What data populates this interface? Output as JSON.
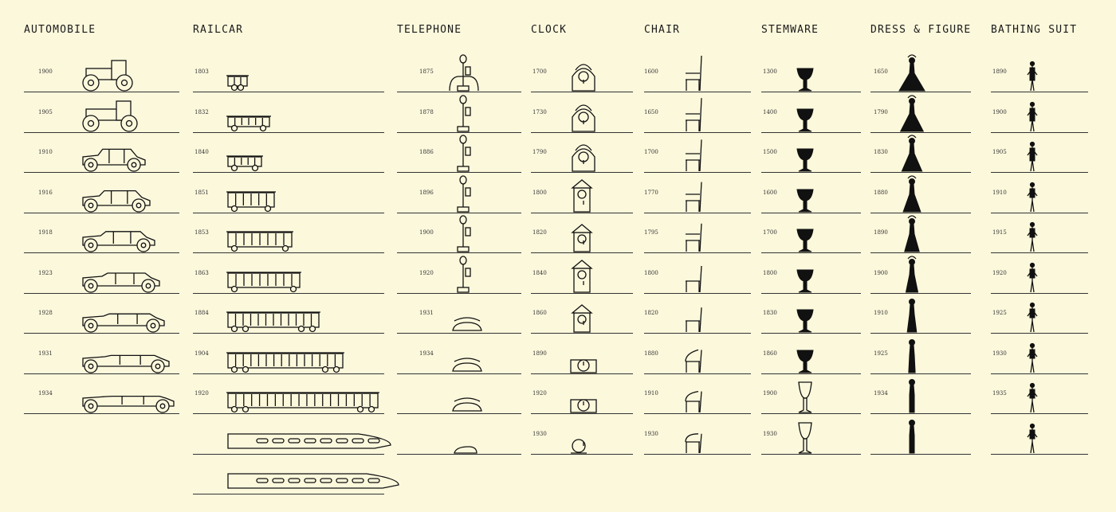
{
  "columns": [
    {
      "id": "automobile",
      "title": "AUTOMOBILE",
      "icon": "automobile-icon",
      "years": [
        "1900",
        "1905",
        "1910",
        "1916",
        "1918",
        "1923",
        "1928",
        "1931",
        "1934"
      ]
    },
    {
      "id": "railcar",
      "title": "RAILCAR",
      "icon": "railcar-icon",
      "years": [
        "1803",
        "1832",
        "1840",
        "1851",
        "1853",
        "1863",
        "1884",
        "1904",
        "1920",
        "",
        ""
      ]
    },
    {
      "id": "telephone",
      "title": "TELEPHONE",
      "icon": "telephone-icon",
      "years": [
        "1875",
        "1878",
        "1886",
        "1896",
        "1900",
        "1920",
        "1931",
        "1934",
        "",
        ""
      ]
    },
    {
      "id": "clock",
      "title": "CLOCK",
      "icon": "clock-icon",
      "years": [
        "1700",
        "1730",
        "1790",
        "1800",
        "1820",
        "1840",
        "1860",
        "1890",
        "1920",
        "1930"
      ]
    },
    {
      "id": "chair",
      "title": "CHAIR",
      "icon": "chair-icon",
      "years": [
        "1600",
        "1650",
        "1700",
        "1770",
        "1795",
        "1800",
        "1820",
        "1880",
        "1910",
        "1930"
      ]
    },
    {
      "id": "stemware",
      "title": "STEMWARE",
      "icon": "goblet-icon",
      "years": [
        "1300",
        "1400",
        "1500",
        "1600",
        "1700",
        "1800",
        "1830",
        "1860",
        "1900",
        "1930"
      ]
    },
    {
      "id": "dress",
      "title": "DRESS & FIGURE",
      "icon": "dress-figure-icon",
      "years": [
        "1650",
        "1790",
        "1830",
        "1880",
        "1890",
        "1900",
        "1910",
        "1925",
        "1934",
        ""
      ]
    },
    {
      "id": "bathing",
      "title": "BATHING SUIT",
      "icon": "bathing-suit-figure-icon",
      "years": [
        "1890",
        "1900",
        "1905",
        "1910",
        "1915",
        "1920",
        "1925",
        "1930",
        "1935",
        ""
      ]
    }
  ],
  "colors": {
    "background": "#fcf8dc",
    "ink": "#111111"
  }
}
